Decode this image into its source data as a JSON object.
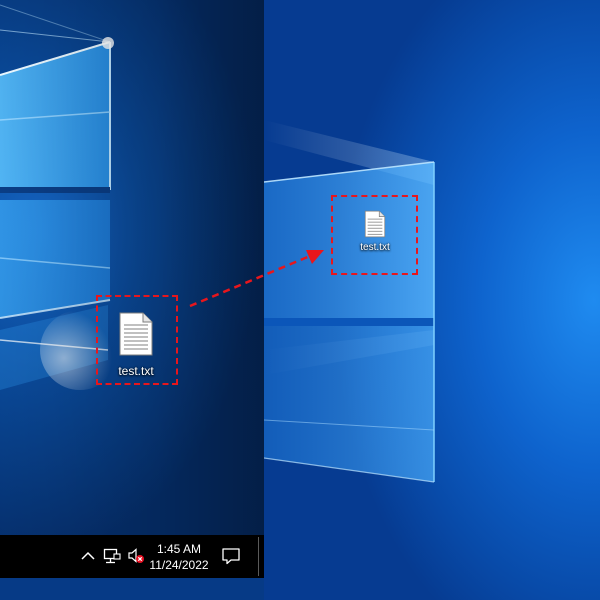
{
  "desktop": {
    "source_icon": {
      "name": "test.txt",
      "icon": "text-file-icon"
    },
    "target_icon": {
      "name": "test.txt",
      "icon": "text-file-icon"
    }
  },
  "taskbar": {
    "tray": {
      "chevron_icon": "chevron-up-icon",
      "network_icon": "network-icon",
      "volume_icon": "volume-muted-icon",
      "notification_icon": "action-center-icon"
    },
    "clock": {
      "time": "1:45 AM",
      "date": "11/24/2022"
    }
  },
  "annotations": {
    "highlight_color": "#e8161c",
    "arrow_direction": "source-to-target"
  },
  "colors": {
    "wallpaper_blue": "#0e63cd",
    "taskbar_bg": "#000000",
    "label_text": "#ffffff"
  }
}
